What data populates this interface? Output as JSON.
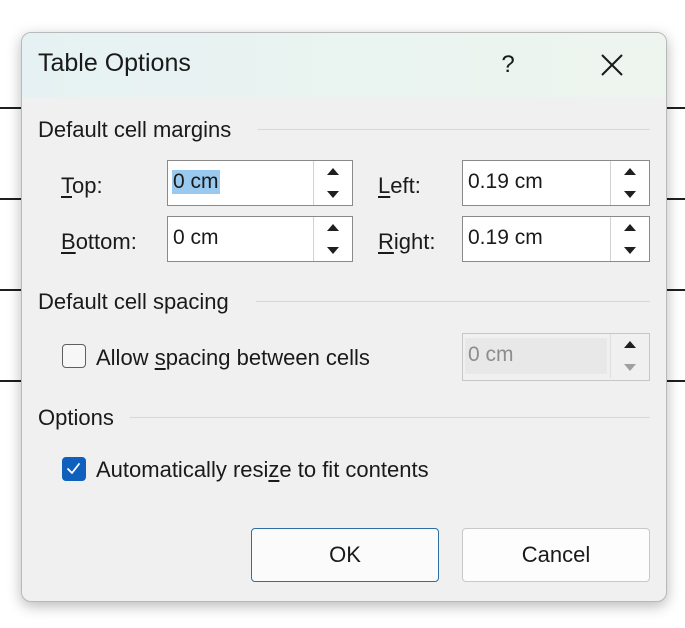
{
  "dialog": {
    "title": "Table Options",
    "help_label": "?",
    "close_icon": "close-icon"
  },
  "margins": {
    "heading": "Default cell margins",
    "top": {
      "mnemonic": "T",
      "rest": "op:",
      "value": "0 cm"
    },
    "bottom": {
      "mnemonic": "B",
      "rest": "ottom:",
      "value": "0 cm"
    },
    "left": {
      "mnemonic": "L",
      "rest": "eft:",
      "value": "0.19 cm"
    },
    "right": {
      "mnemonic": "R",
      "rest": "ight:",
      "value": "0.19 cm"
    }
  },
  "spacing": {
    "heading": "Default cell spacing",
    "checkbox_before": "Allow ",
    "checkbox_mnemonic": "s",
    "checkbox_after": "pacing between cells",
    "checked": false,
    "value": "0 cm"
  },
  "options": {
    "heading": "Options",
    "autoresize_before": "Automatically resize to fit contents",
    "autoresize_pre": "Automatically resi",
    "autoresize_mnemonic": "z",
    "autoresize_post": "e to fit contents",
    "checked": true
  },
  "buttons": {
    "ok": "OK",
    "cancel": "Cancel"
  },
  "colors": {
    "accent": "#0f5fbd",
    "selection": "#99c9ef"
  }
}
